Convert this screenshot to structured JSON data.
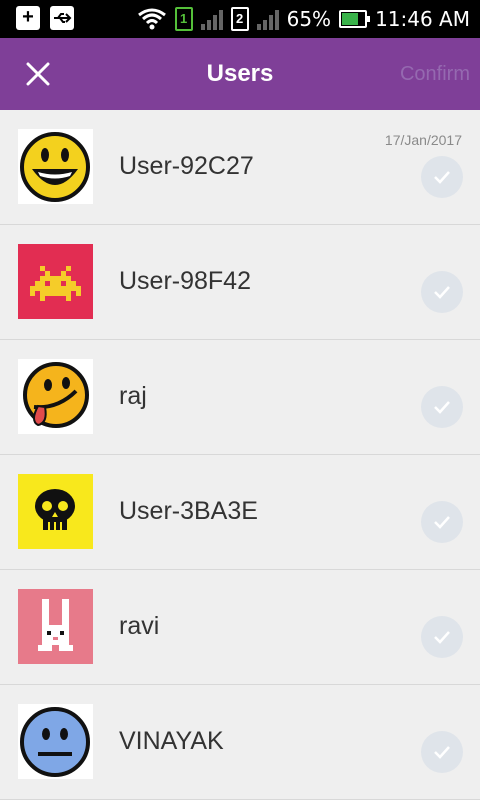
{
  "status_bar": {
    "sim1": "1",
    "sim2": "2",
    "battery": "65%",
    "time": "11:46 AM",
    "icons": [
      "add-notification-icon",
      "usb-icon",
      "wifi-icon",
      "signal-icon",
      "battery-charging-icon"
    ]
  },
  "app_bar": {
    "title": "Users",
    "confirm_label": "Confirm",
    "background": "#7f3f98"
  },
  "users": [
    {
      "name": "User-92C27",
      "date": "17/Jan/2017",
      "avatar": "smiley-grin-icon"
    },
    {
      "name": "User-98F42",
      "date": "",
      "avatar": "space-invader-icon"
    },
    {
      "name": "raj",
      "date": "",
      "avatar": "smiley-tongue-icon"
    },
    {
      "name": "User-3BA3E",
      "date": "",
      "avatar": "skull-icon"
    },
    {
      "name": "ravi",
      "date": "",
      "avatar": "bunny-icon"
    },
    {
      "name": "VINAYAK",
      "date": "",
      "avatar": "neutral-face-icon"
    }
  ]
}
